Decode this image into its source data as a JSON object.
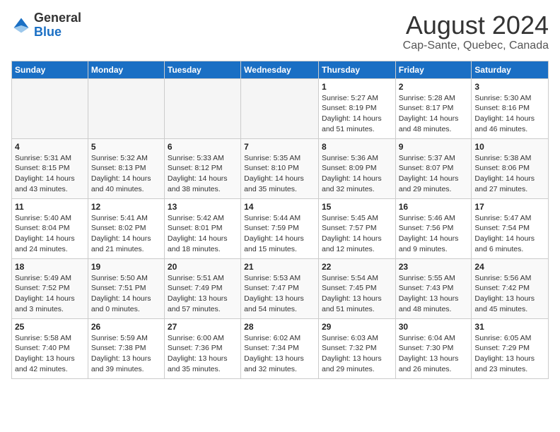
{
  "header": {
    "logo_general": "General",
    "logo_blue": "Blue",
    "title": "August 2024",
    "subtitle": "Cap-Sante, Quebec, Canada"
  },
  "weekdays": [
    "Sunday",
    "Monday",
    "Tuesday",
    "Wednesday",
    "Thursday",
    "Friday",
    "Saturday"
  ],
  "weeks": [
    [
      {
        "day": "",
        "info": ""
      },
      {
        "day": "",
        "info": ""
      },
      {
        "day": "",
        "info": ""
      },
      {
        "day": "",
        "info": ""
      },
      {
        "day": "1",
        "info": "Sunrise: 5:27 AM\nSunset: 8:19 PM\nDaylight: 14 hours\nand 51 minutes."
      },
      {
        "day": "2",
        "info": "Sunrise: 5:28 AM\nSunset: 8:17 PM\nDaylight: 14 hours\nand 48 minutes."
      },
      {
        "day": "3",
        "info": "Sunrise: 5:30 AM\nSunset: 8:16 PM\nDaylight: 14 hours\nand 46 minutes."
      }
    ],
    [
      {
        "day": "4",
        "info": "Sunrise: 5:31 AM\nSunset: 8:15 PM\nDaylight: 14 hours\nand 43 minutes."
      },
      {
        "day": "5",
        "info": "Sunrise: 5:32 AM\nSunset: 8:13 PM\nDaylight: 14 hours\nand 40 minutes."
      },
      {
        "day": "6",
        "info": "Sunrise: 5:33 AM\nSunset: 8:12 PM\nDaylight: 14 hours\nand 38 minutes."
      },
      {
        "day": "7",
        "info": "Sunrise: 5:35 AM\nSunset: 8:10 PM\nDaylight: 14 hours\nand 35 minutes."
      },
      {
        "day": "8",
        "info": "Sunrise: 5:36 AM\nSunset: 8:09 PM\nDaylight: 14 hours\nand 32 minutes."
      },
      {
        "day": "9",
        "info": "Sunrise: 5:37 AM\nSunset: 8:07 PM\nDaylight: 14 hours\nand 29 minutes."
      },
      {
        "day": "10",
        "info": "Sunrise: 5:38 AM\nSunset: 8:06 PM\nDaylight: 14 hours\nand 27 minutes."
      }
    ],
    [
      {
        "day": "11",
        "info": "Sunrise: 5:40 AM\nSunset: 8:04 PM\nDaylight: 14 hours\nand 24 minutes."
      },
      {
        "day": "12",
        "info": "Sunrise: 5:41 AM\nSunset: 8:02 PM\nDaylight: 14 hours\nand 21 minutes."
      },
      {
        "day": "13",
        "info": "Sunrise: 5:42 AM\nSunset: 8:01 PM\nDaylight: 14 hours\nand 18 minutes."
      },
      {
        "day": "14",
        "info": "Sunrise: 5:44 AM\nSunset: 7:59 PM\nDaylight: 14 hours\nand 15 minutes."
      },
      {
        "day": "15",
        "info": "Sunrise: 5:45 AM\nSunset: 7:57 PM\nDaylight: 14 hours\nand 12 minutes."
      },
      {
        "day": "16",
        "info": "Sunrise: 5:46 AM\nSunset: 7:56 PM\nDaylight: 14 hours\nand 9 minutes."
      },
      {
        "day": "17",
        "info": "Sunrise: 5:47 AM\nSunset: 7:54 PM\nDaylight: 14 hours\nand 6 minutes."
      }
    ],
    [
      {
        "day": "18",
        "info": "Sunrise: 5:49 AM\nSunset: 7:52 PM\nDaylight: 14 hours\nand 3 minutes."
      },
      {
        "day": "19",
        "info": "Sunrise: 5:50 AM\nSunset: 7:51 PM\nDaylight: 14 hours\nand 0 minutes."
      },
      {
        "day": "20",
        "info": "Sunrise: 5:51 AM\nSunset: 7:49 PM\nDaylight: 13 hours\nand 57 minutes."
      },
      {
        "day": "21",
        "info": "Sunrise: 5:53 AM\nSunset: 7:47 PM\nDaylight: 13 hours\nand 54 minutes."
      },
      {
        "day": "22",
        "info": "Sunrise: 5:54 AM\nSunset: 7:45 PM\nDaylight: 13 hours\nand 51 minutes."
      },
      {
        "day": "23",
        "info": "Sunrise: 5:55 AM\nSunset: 7:43 PM\nDaylight: 13 hours\nand 48 minutes."
      },
      {
        "day": "24",
        "info": "Sunrise: 5:56 AM\nSunset: 7:42 PM\nDaylight: 13 hours\nand 45 minutes."
      }
    ],
    [
      {
        "day": "25",
        "info": "Sunrise: 5:58 AM\nSunset: 7:40 PM\nDaylight: 13 hours\nand 42 minutes."
      },
      {
        "day": "26",
        "info": "Sunrise: 5:59 AM\nSunset: 7:38 PM\nDaylight: 13 hours\nand 39 minutes."
      },
      {
        "day": "27",
        "info": "Sunrise: 6:00 AM\nSunset: 7:36 PM\nDaylight: 13 hours\nand 35 minutes."
      },
      {
        "day": "28",
        "info": "Sunrise: 6:02 AM\nSunset: 7:34 PM\nDaylight: 13 hours\nand 32 minutes."
      },
      {
        "day": "29",
        "info": "Sunrise: 6:03 AM\nSunset: 7:32 PM\nDaylight: 13 hours\nand 29 minutes."
      },
      {
        "day": "30",
        "info": "Sunrise: 6:04 AM\nSunset: 7:30 PM\nDaylight: 13 hours\nand 26 minutes."
      },
      {
        "day": "31",
        "info": "Sunrise: 6:05 AM\nSunset: 7:29 PM\nDaylight: 13 hours\nand 23 minutes."
      }
    ]
  ]
}
